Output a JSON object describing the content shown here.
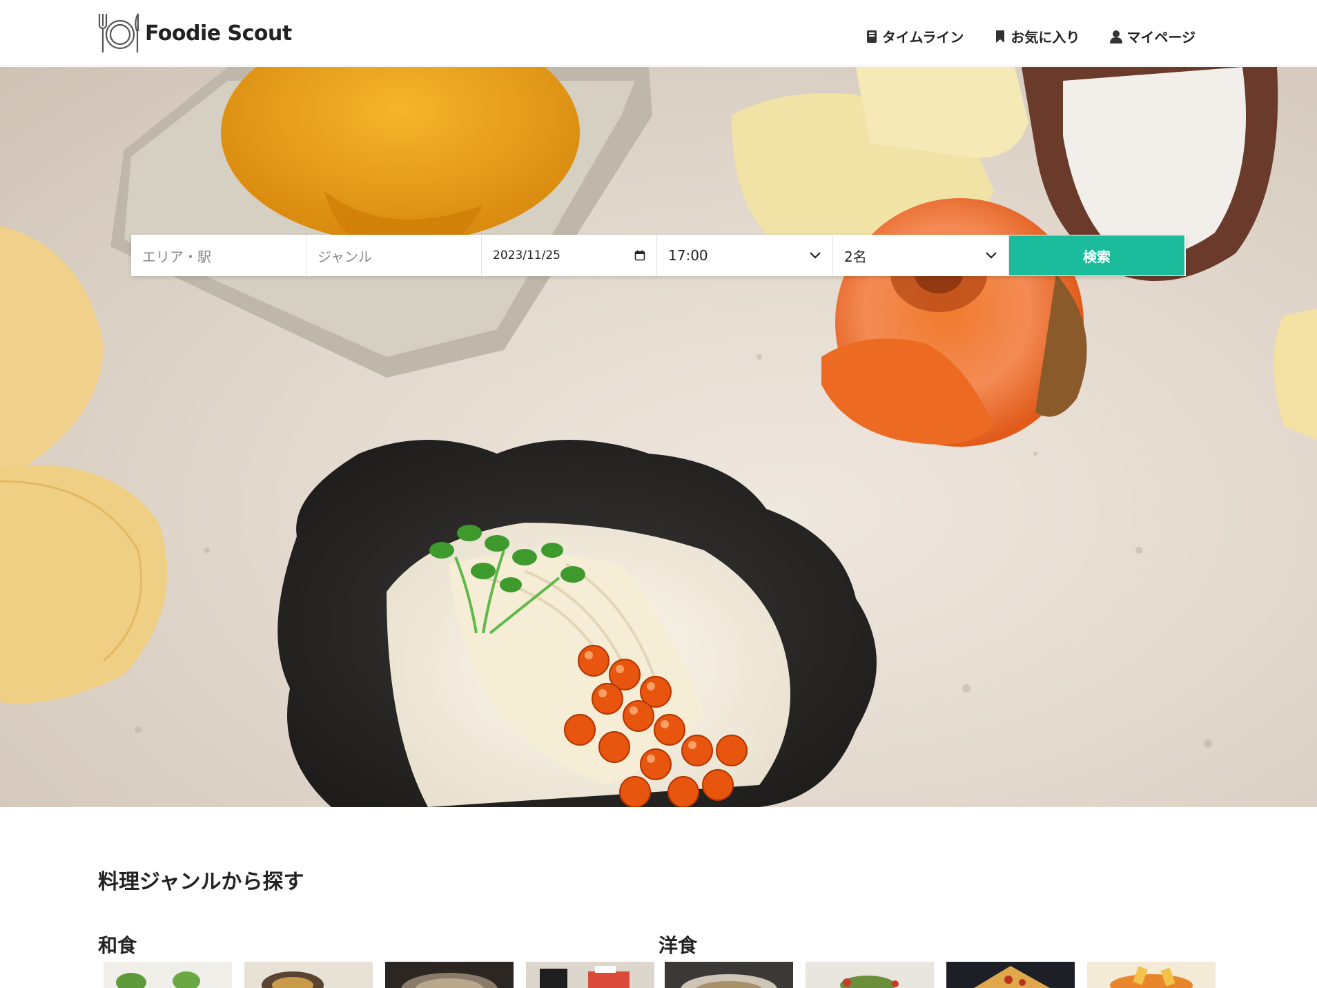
{
  "brand": {
    "name": "Foodie Scout"
  },
  "nav": {
    "timeline": "タイムライン",
    "favorites": "お気に入り",
    "mypage": "マイページ"
  },
  "search": {
    "area_placeholder": "エリア・駅",
    "genre_placeholder": "ジャンル",
    "date": "2023/11/25",
    "time": "17:00",
    "people": "2名",
    "button": "検索"
  },
  "genres": {
    "title": "料理ジャンルから探す",
    "japanese": "和食",
    "western": "洋食"
  },
  "colors": {
    "accent": "#1bbc9b"
  }
}
